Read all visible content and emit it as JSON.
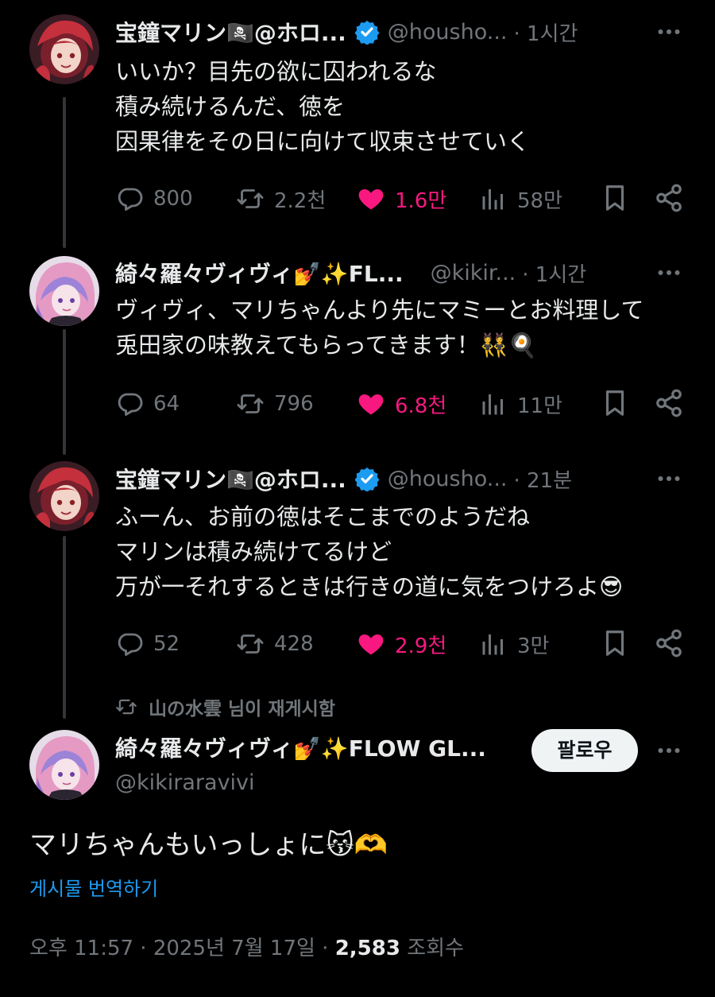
{
  "tweets": [
    {
      "name": "宝鐘マリン🏴‍☠️@ホロ...",
      "handle": "@housho...",
      "time": "· 1시간",
      "body": "いいか？目先の欲に囚われるな\n積み続けるんだ、徳を\n因果律をその日に向けて収束させていく",
      "replies": "800",
      "reposts": "2.2천",
      "likes": "1.6만",
      "views": "58만"
    },
    {
      "name": "綺々羅々ヴィヴィ💅✨FL...",
      "handle": "@kikir...",
      "time": "· 1시간",
      "body": "ヴィヴィ、マリちゃんより先にマミーとお料理して\n兎田家の味教えてもらってきます！👯🍳",
      "replies": "64",
      "reposts": "796",
      "likes": "6.8천",
      "views": "11만"
    },
    {
      "name": "宝鐘マリン🏴‍☠️@ホロ...",
      "handle": "@housho...",
      "time": "· 21분",
      "body": "ふーん、お前の徳はそこまでのようだね\nマリンは積み続けてるけど\n万が一それするときは行きの道に気をつけろよ😎",
      "replies": "52",
      "reposts": "428",
      "likes": "2.9천",
      "views": "3만"
    }
  ],
  "repost_note": "山の水雲 님이 재게시함",
  "main": {
    "name": "綺々羅々ヴィヴィ💅✨FLOW GL...",
    "handle": "@kikiraravivi",
    "follow_label": "팔로우",
    "text": "マリちゃんもいっしょに😽🫶",
    "translate_label": "게시물 번역하기",
    "meta_time": "오후 11:57 · 2025년 7월 17일 · ",
    "meta_views_count": "2,583",
    "meta_views_label": " 조회수"
  },
  "colors": {
    "background": "#000000",
    "text": "#e7e9ea",
    "muted": "#71767b",
    "like": "#f91880",
    "link": "#1d9bf0",
    "verified": "#1d9bf0"
  },
  "icons": [
    "reply-icon",
    "repost-icon",
    "heart-icon",
    "views-icon",
    "bookmark-icon",
    "share-icon",
    "more-icon",
    "verified-icon"
  ]
}
